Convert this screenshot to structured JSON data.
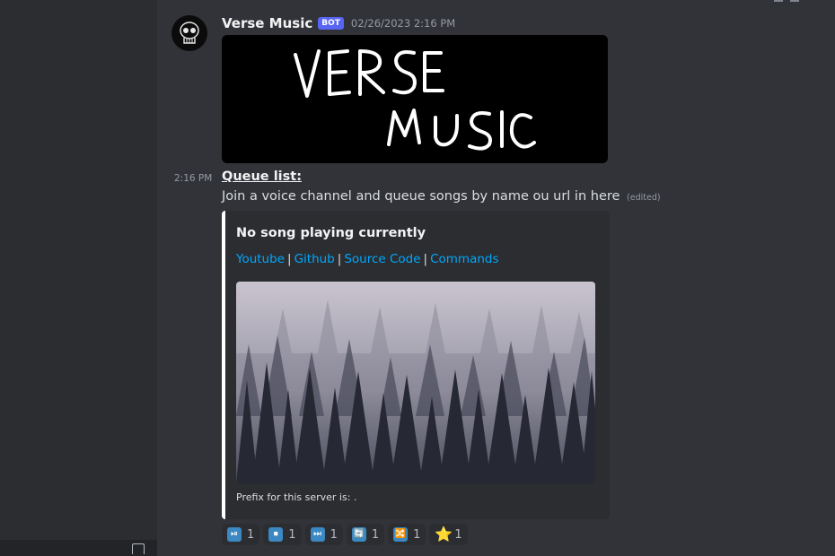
{
  "message": {
    "username": "Verse Music",
    "badge": "BOT",
    "timestamp": "02/26/2023 2:16 PM",
    "banner_text": [
      "VERSE",
      "MUSIC"
    ]
  },
  "followup": {
    "side_time": "2:16 PM",
    "title": "Queue list:",
    "text": "Join a voice channel and queue songs by name ou url in here",
    "edited": "(edited)"
  },
  "embed": {
    "title": "No song playing currently",
    "links": [
      "Youtube",
      "Github",
      "Source Code",
      "Commands"
    ],
    "separator": "|",
    "footer": "Prefix for this server is: .",
    "accent_color": "#ffffff",
    "link_color": "#00a8fc"
  },
  "reactions": [
    {
      "icon": "play-pause-icon",
      "glyph": "⏯",
      "count": "1"
    },
    {
      "icon": "stop-icon",
      "glyph": "⏹",
      "count": "1"
    },
    {
      "icon": "next-track-icon",
      "glyph": "⏭",
      "count": "1"
    },
    {
      "icon": "repeat-icon",
      "glyph": "🔄",
      "count": "1"
    },
    {
      "icon": "shuffle-icon",
      "glyph": "🔀",
      "count": "1"
    },
    {
      "icon": "star-icon",
      "glyph": "⭐",
      "count": "1"
    }
  ]
}
